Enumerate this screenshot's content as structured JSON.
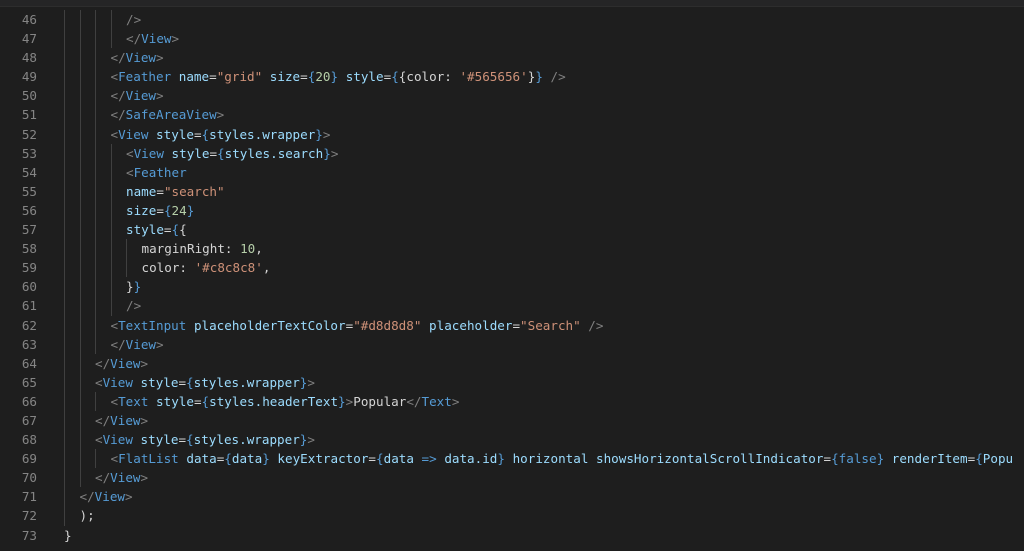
{
  "lines": [
    {
      "n": "46",
      "indent": 4,
      "tokens": [
        [
          "t",
          "/>"
        ]
      ]
    },
    {
      "n": "47",
      "indent": 4,
      "tokens": [
        [
          "t",
          "</"
        ],
        [
          "tn",
          "View"
        ],
        [
          "t",
          ">"
        ]
      ]
    },
    {
      "n": "48",
      "indent": 3,
      "tokens": [
        [
          "t",
          "</"
        ],
        [
          "tn",
          "View"
        ],
        [
          "t",
          ">"
        ]
      ]
    },
    {
      "n": "49",
      "indent": 3,
      "tokens": [
        [
          "t",
          "<"
        ],
        [
          "tn",
          "Feather"
        ],
        [
          "pl",
          " "
        ],
        [
          "at",
          "name"
        ],
        [
          "pl",
          "="
        ],
        [
          "st",
          "\"grid\""
        ],
        [
          "pl",
          " "
        ],
        [
          "at",
          "size"
        ],
        [
          "pl",
          "="
        ],
        [
          "bl",
          "{"
        ],
        [
          "nu",
          "20"
        ],
        [
          "bl",
          "}"
        ],
        [
          "pl",
          " "
        ],
        [
          "at",
          "style"
        ],
        [
          "pl",
          "="
        ],
        [
          "bl",
          "{"
        ],
        [
          "pl",
          "{color: "
        ],
        [
          "st",
          "'#565656'"
        ],
        [
          "pl",
          "}"
        ],
        [
          "bl",
          "}"
        ],
        [
          "pl",
          " "
        ],
        [
          "t",
          "/>"
        ]
      ]
    },
    {
      "n": "50",
      "indent": 3,
      "tokens": [
        [
          "t",
          "</"
        ],
        [
          "tn",
          "View"
        ],
        [
          "t",
          ">"
        ]
      ]
    },
    {
      "n": "51",
      "indent": 3,
      "tokens": [
        [
          "t",
          "</"
        ],
        [
          "tn",
          "SafeAreaView"
        ],
        [
          "t",
          ">"
        ]
      ]
    },
    {
      "n": "52",
      "indent": 3,
      "tokens": [
        [
          "t",
          "<"
        ],
        [
          "tn",
          "View"
        ],
        [
          "pl",
          " "
        ],
        [
          "at",
          "style"
        ],
        [
          "pl",
          "="
        ],
        [
          "bl",
          "{"
        ],
        [
          "at",
          "styles.wrapper"
        ],
        [
          "bl",
          "}"
        ],
        [
          "t",
          ">"
        ]
      ]
    },
    {
      "n": "53",
      "indent": 4,
      "tokens": [
        [
          "t",
          "<"
        ],
        [
          "tn",
          "View"
        ],
        [
          "pl",
          " "
        ],
        [
          "at",
          "style"
        ],
        [
          "pl",
          "="
        ],
        [
          "bl",
          "{"
        ],
        [
          "at",
          "styles.search"
        ],
        [
          "bl",
          "}"
        ],
        [
          "t",
          ">"
        ]
      ]
    },
    {
      "n": "54",
      "indent": 4,
      "tokens": [
        [
          "t",
          "<"
        ],
        [
          "tn",
          "Feather"
        ]
      ]
    },
    {
      "n": "55",
      "indent": 4,
      "tokens": [
        [
          "at",
          "name"
        ],
        [
          "pl",
          "="
        ],
        [
          "st",
          "\"search\""
        ]
      ]
    },
    {
      "n": "56",
      "indent": 4,
      "tokens": [
        [
          "at",
          "size"
        ],
        [
          "pl",
          "="
        ],
        [
          "bl",
          "{"
        ],
        [
          "nu",
          "24"
        ],
        [
          "bl",
          "}"
        ]
      ]
    },
    {
      "n": "57",
      "indent": 4,
      "tokens": [
        [
          "at",
          "style"
        ],
        [
          "pl",
          "="
        ],
        [
          "bl",
          "{"
        ],
        [
          "pl",
          "{"
        ]
      ]
    },
    {
      "n": "58",
      "indent": 5,
      "tokens": [
        [
          "pl",
          "marginRight: "
        ],
        [
          "nu",
          "10"
        ],
        [
          "pl",
          ","
        ]
      ]
    },
    {
      "n": "59",
      "indent": 5,
      "tokens": [
        [
          "pl",
          "color: "
        ],
        [
          "st",
          "'#c8c8c8'"
        ],
        [
          "pl",
          ","
        ]
      ]
    },
    {
      "n": "60",
      "indent": 4,
      "tokens": [
        [
          "pl",
          "}"
        ],
        [
          "bl",
          "}"
        ]
      ]
    },
    {
      "n": "61",
      "indent": 4,
      "tokens": [
        [
          "t",
          "/>"
        ]
      ]
    },
    {
      "n": "62",
      "indent": 3,
      "tokens": [
        [
          "t",
          "<"
        ],
        [
          "tn",
          "TextInput"
        ],
        [
          "pl",
          " "
        ],
        [
          "at",
          "placeholderTextColor"
        ],
        [
          "pl",
          "="
        ],
        [
          "st",
          "\"#d8d8d8\""
        ],
        [
          "pl",
          " "
        ],
        [
          "at",
          "placeholder"
        ],
        [
          "pl",
          "="
        ],
        [
          "st",
          "\"Search\""
        ],
        [
          "pl",
          " "
        ],
        [
          "t",
          "/>"
        ]
      ]
    },
    {
      "n": "63",
      "indent": 3,
      "tokens": [
        [
          "t",
          "</"
        ],
        [
          "tn",
          "View"
        ],
        [
          "t",
          ">"
        ]
      ]
    },
    {
      "n": "64",
      "indent": 2,
      "tokens": [
        [
          "t",
          "</"
        ],
        [
          "tn",
          "View"
        ],
        [
          "t",
          ">"
        ]
      ]
    },
    {
      "n": "65",
      "indent": 2,
      "tokens": [
        [
          "t",
          "<"
        ],
        [
          "tn",
          "View"
        ],
        [
          "pl",
          " "
        ],
        [
          "at",
          "style"
        ],
        [
          "pl",
          "="
        ],
        [
          "bl",
          "{"
        ],
        [
          "at",
          "styles.wrapper"
        ],
        [
          "bl",
          "}"
        ],
        [
          "t",
          ">"
        ]
      ]
    },
    {
      "n": "66",
      "indent": 3,
      "tokens": [
        [
          "t",
          "<"
        ],
        [
          "tn",
          "Text"
        ],
        [
          "pl",
          " "
        ],
        [
          "at",
          "style"
        ],
        [
          "pl",
          "="
        ],
        [
          "bl",
          "{"
        ],
        [
          "at",
          "styles.headerText"
        ],
        [
          "bl",
          "}"
        ],
        [
          "t",
          ">"
        ],
        [
          "pl",
          "Popular"
        ],
        [
          "t",
          "</"
        ],
        [
          "tn",
          "Text"
        ],
        [
          "t",
          ">"
        ]
      ]
    },
    {
      "n": "67",
      "indent": 2,
      "tokens": [
        [
          "t",
          "</"
        ],
        [
          "tn",
          "View"
        ],
        [
          "t",
          ">"
        ]
      ]
    },
    {
      "n": "68",
      "indent": 2,
      "tokens": [
        [
          "t",
          "<"
        ],
        [
          "tn",
          "View"
        ],
        [
          "pl",
          " "
        ],
        [
          "at",
          "style"
        ],
        [
          "pl",
          "="
        ],
        [
          "bl",
          "{"
        ],
        [
          "at",
          "styles.wrapper"
        ],
        [
          "bl",
          "}"
        ],
        [
          "t",
          ">"
        ]
      ]
    },
    {
      "n": "69",
      "indent": 3,
      "tokens": [
        [
          "t",
          "<"
        ],
        [
          "tn",
          "FlatList"
        ],
        [
          "pl",
          " "
        ],
        [
          "at",
          "data"
        ],
        [
          "pl",
          "="
        ],
        [
          "bl",
          "{"
        ],
        [
          "at",
          "data"
        ],
        [
          "bl",
          "}"
        ],
        [
          "pl",
          " "
        ],
        [
          "at",
          "keyExtractor"
        ],
        [
          "pl",
          "="
        ],
        [
          "bl",
          "{"
        ],
        [
          "at",
          "data"
        ],
        [
          "pl",
          " "
        ],
        [
          "bl",
          "=>"
        ],
        [
          "pl",
          " "
        ],
        [
          "at",
          "data.id"
        ],
        [
          "bl",
          "}"
        ],
        [
          "pl",
          " "
        ],
        [
          "at",
          "horizontal"
        ],
        [
          "pl",
          " "
        ],
        [
          "at",
          "showsHorizontalScrollIndicator"
        ],
        [
          "pl",
          "="
        ],
        [
          "bl",
          "{"
        ],
        [
          "bl",
          "false"
        ],
        [
          "bl",
          "}"
        ],
        [
          "pl",
          " "
        ],
        [
          "at",
          "renderItem"
        ],
        [
          "pl",
          "="
        ],
        [
          "bl",
          "{"
        ],
        [
          "at",
          "Popu"
        ]
      ]
    },
    {
      "n": "70",
      "indent": 2,
      "tokens": [
        [
          "t",
          "</"
        ],
        [
          "tn",
          "View"
        ],
        [
          "t",
          ">"
        ]
      ]
    },
    {
      "n": "71",
      "indent": 1,
      "tokens": [
        [
          "t",
          "</"
        ],
        [
          "tn",
          "View"
        ],
        [
          "t",
          ">"
        ]
      ]
    },
    {
      "n": "72",
      "indent": 1,
      "tokens": [
        [
          "pl",
          ");"
        ]
      ]
    },
    {
      "n": "73",
      "indent": 0,
      "tokens": [
        [
          "pl",
          "}"
        ]
      ]
    }
  ]
}
